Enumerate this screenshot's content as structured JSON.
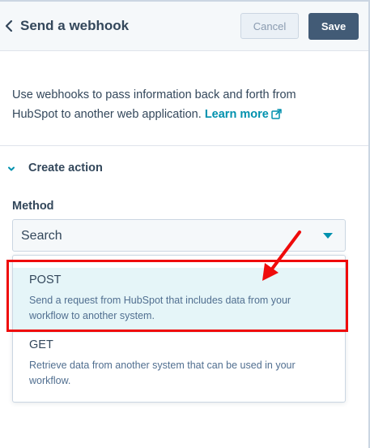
{
  "header": {
    "title": "Send a webhook",
    "cancel_label": "Cancel",
    "save_label": "Save",
    "back_icon": "chevron-left-icon"
  },
  "intro": {
    "text": "Use webhooks to pass information back and forth from HubSpot to another web application.",
    "learn_more": "Learn more",
    "external_icon": "external-link-icon"
  },
  "section": {
    "title": "Create action",
    "expanded": true
  },
  "method": {
    "label": "Method",
    "value": "Search",
    "options": [
      {
        "label": "POST",
        "description": "Send a request from HubSpot that includes data from your workflow to another system.",
        "highlighted": true
      },
      {
        "label": "GET",
        "description": "Retrieve data from another system that can be used in your workflow.",
        "highlighted": false
      }
    ]
  },
  "colors": {
    "accent": "#0091ae",
    "primary_button": "#425b76",
    "annotation": "#ef0b0b",
    "option_hover": "#e5f5f8"
  }
}
